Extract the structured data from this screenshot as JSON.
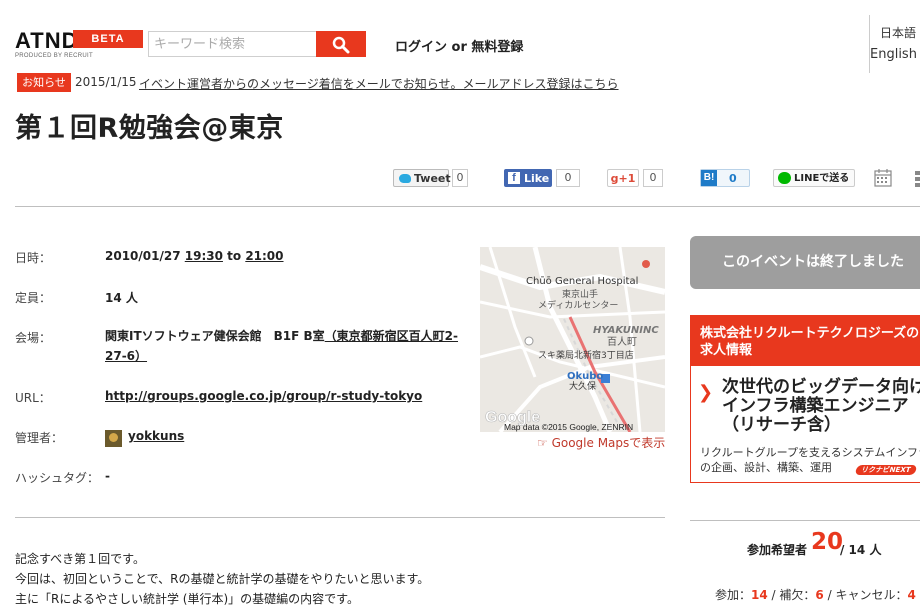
{
  "header": {
    "logo_text": "ATND",
    "logo_badge": "BETA",
    "logo_sub": "PRODUCED BY RECRUIT",
    "search_placeholder": "キーワード検索",
    "login_label": "ログイン or 無料登録",
    "lang_ja": "日本語",
    "lang_en": "English"
  },
  "notice": {
    "badge": "お知らせ",
    "date": "2015/1/15",
    "text": "イベント運営者からのメッセージ着信をメールでお知らせ。メールアドレス登録はこちら"
  },
  "event": {
    "title": "第１回R勉強会@東京"
  },
  "social": {
    "tweet_label": "Tweet",
    "tweet_count": "0",
    "like_label": "Like",
    "like_count": "0",
    "gplus_label": "g+1",
    "gplus_count": "0",
    "hatena_count": "0",
    "line_label": "LINEで送る"
  },
  "details": {
    "date_label": "日時：",
    "date_value": "2010/01/27",
    "time_start": "19:30",
    "time_sep": "to",
    "time_end": "21:00",
    "capacity_label": "定員：",
    "capacity_value": "14 人",
    "venue_label": "会場：",
    "venue_name": "関東ITソフトウェア健保会館　B1F B室",
    "venue_address": "（東京都新宿区百人町2-27-6）",
    "url_label": "URL：",
    "url_value": "http://groups.google.co.jp/group/r-study-tokyo",
    "organizer_label": "管理者：",
    "organizer_name": "yokkuns",
    "hashtag_label": "ハッシュタグ：",
    "hashtag_value": "-"
  },
  "map": {
    "labels": [
      "Chūō General Hospital",
      "東京山手",
      "メディカルセンター",
      "HYAKUNINC",
      "百人町",
      "スキ薬局北新宿3丁目店",
      "Okubo",
      "大久保"
    ],
    "logo": "Google",
    "attribution": "Map data ©2015 Google, ZENRIN",
    "link_text": "☞ Google Mapsで表示"
  },
  "description": [
    "記念すべき第１回です。",
    "今回は、初回ということで、Rの基礎と統計学の基礎をやりたいと思います。",
    "主に「Rによるやさしい統計学 (単行本)」の基礎編の内容です。"
  ],
  "sidebar": {
    "ended_text": "このイベントは終了しました",
    "ad_head_line1": "株式会社リクルートテクノロジーズの",
    "ad_head_line2": "求人情報",
    "ad_main_line1": "次世代のビッグデータ向け",
    "ad_main_line2": "インフラ構築エンジニア",
    "ad_main_line3": "（リサーチ含）",
    "ad_sub_line1": "リクルートグループを支えるシステムインフラ",
    "ad_sub_line2": "の企画、設計、構築、運用",
    "ad_logo": "リクナビNEXT",
    "attend_label": "参加希望者",
    "attend_count": "20",
    "attend_capacity": "/ 14 人",
    "stat_join_label": "参加：",
    "stat_join": "14",
    "stat_wait_label": "/ 補欠：",
    "stat_wait": "6",
    "stat_cancel_label": "/ キャンセル：",
    "stat_cancel": "4"
  },
  "colors": {
    "accent": "#e8381e",
    "ended_bg": "#9e9e9e",
    "facebook": "#4267b2",
    "line": "#00b900",
    "hatena": "#1e7bc8"
  }
}
